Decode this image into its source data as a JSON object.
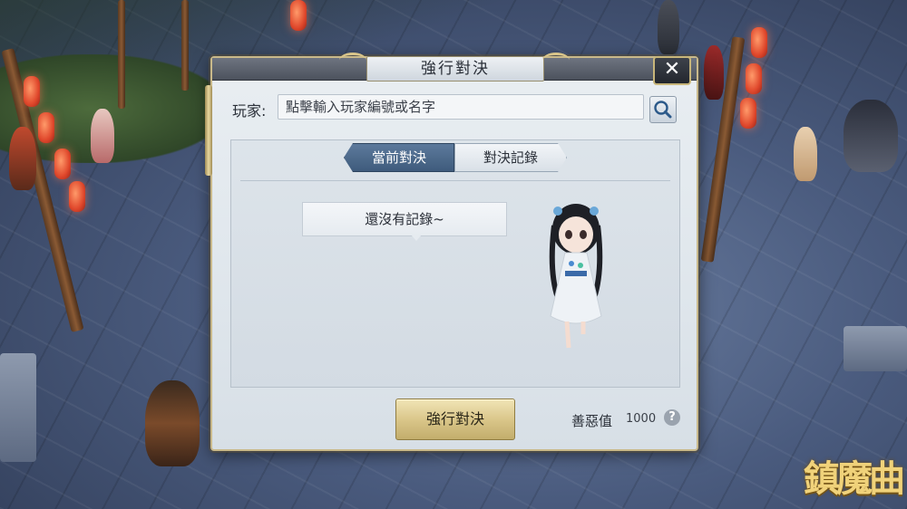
{
  "dialog": {
    "title": "強行對決",
    "close_label": "✕",
    "player_label": "玩家:",
    "search_placeholder": "點擊輸入玩家編號或名字",
    "tabs": [
      {
        "label": "當前對決",
        "active": true
      },
      {
        "label": "對決記錄",
        "active": false
      }
    ],
    "empty_message": "還沒有記錄~",
    "duel_button_label": "強行對決",
    "karma_label": "善惡值",
    "karma_value": "1000",
    "help_label": "?"
  },
  "game": {
    "logo_text": "鎮魔曲"
  },
  "icons": {
    "search": "search-icon",
    "close": "close-icon",
    "help": "question-mark-icon"
  },
  "colors": {
    "active_tab": "#4a6788",
    "duel_button": "#d8c487",
    "dialog_border": "#c9b98a"
  }
}
